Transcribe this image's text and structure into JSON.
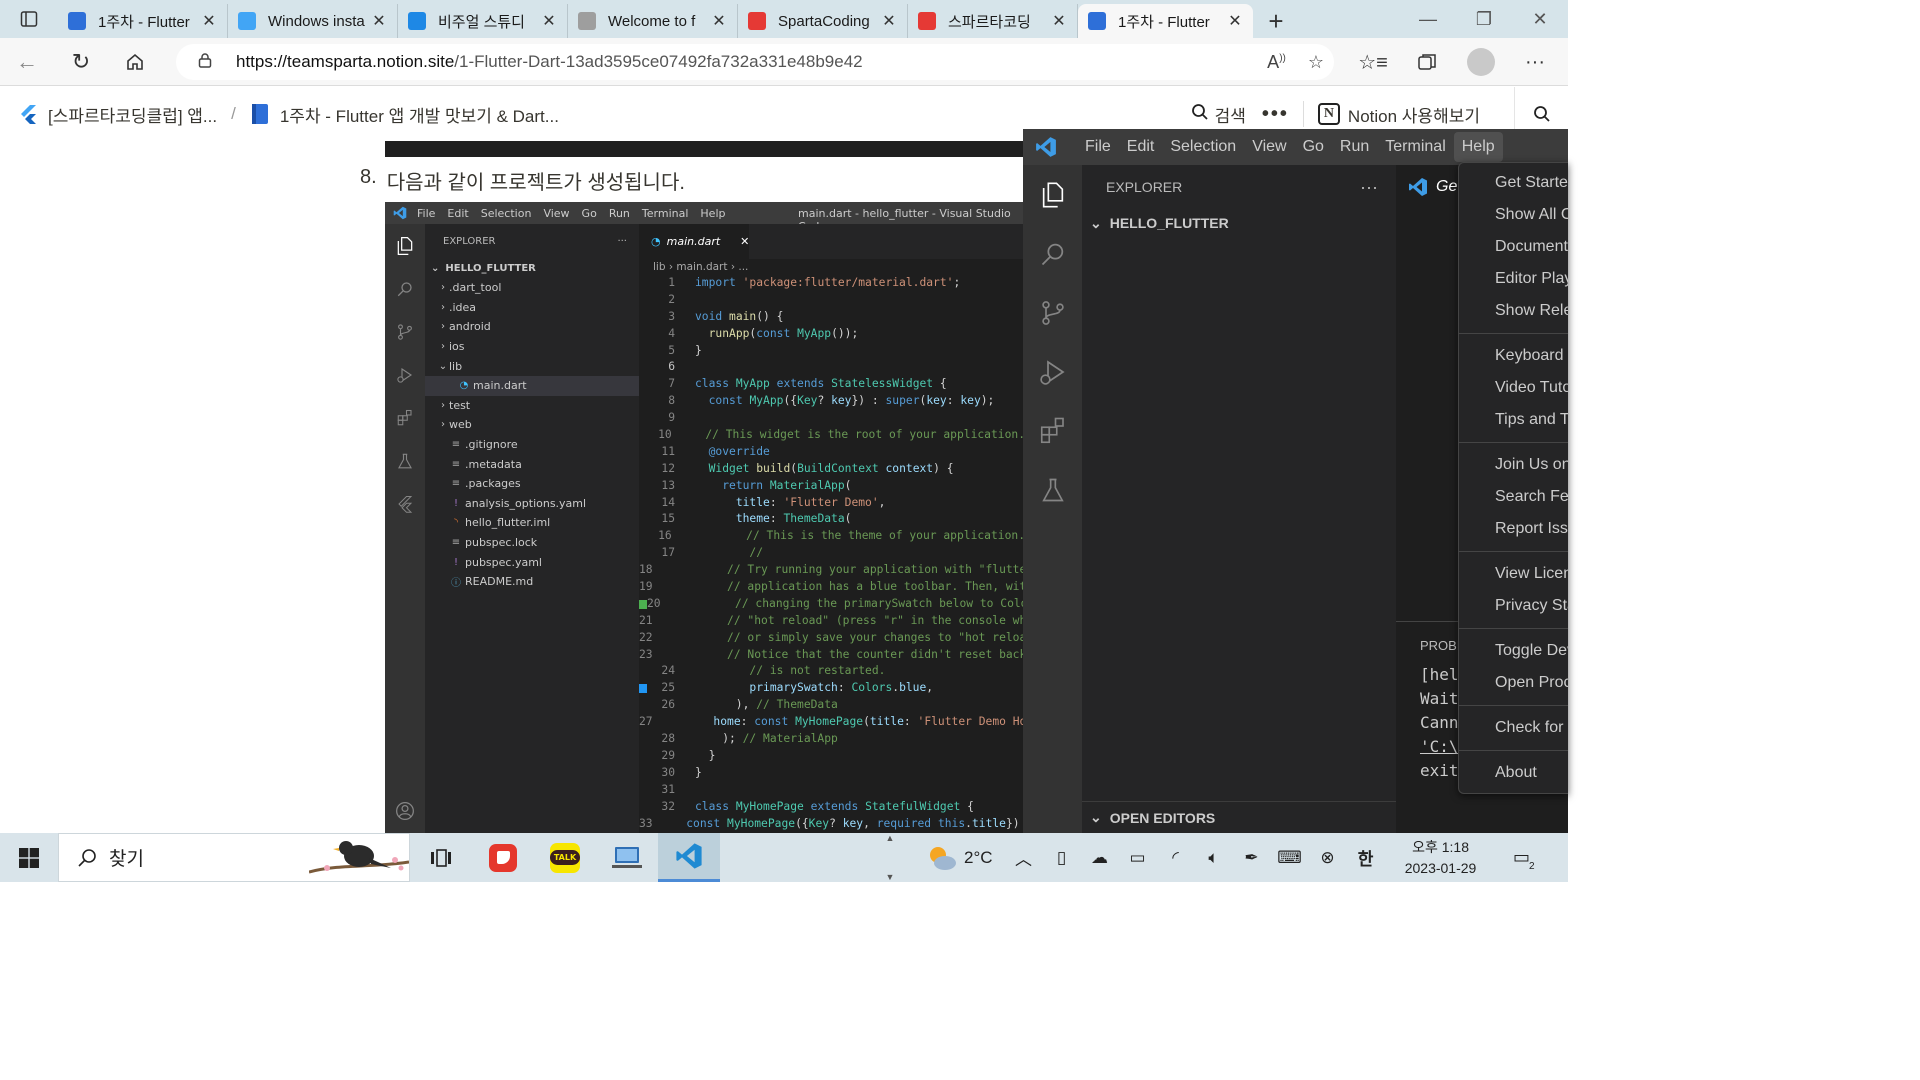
{
  "browser": {
    "tabs": [
      {
        "title": "1주차 - Flutter",
        "favicon": "notion-page-icon",
        "color": "#2e6fd8",
        "active": false
      },
      {
        "title": "Windows insta",
        "favicon": "flutter-icon",
        "color": "#42a5f5",
        "active": false
      },
      {
        "title": "비주얼 스튜디",
        "favicon": "vscode-icon",
        "color": "#1e88e5",
        "active": false
      },
      {
        "title": "Welcome to f",
        "favicon": "globe-icon",
        "color": "#9e9e9e",
        "active": false
      },
      {
        "title": "SpartaCoding",
        "favicon": "sparta-icon",
        "color": "#e53935",
        "active": false
      },
      {
        "title": "스파르타코딩",
        "favicon": "sparta-heart-icon",
        "color": "#e53935",
        "active": false
      },
      {
        "title": "1주차 - Flutter",
        "favicon": "notion-page-icon",
        "color": "#2e6fd8",
        "active": true
      }
    ],
    "url_host": "https://teamsparta.notion.site",
    "url_path": "/1-Flutter-Dart-13ad3595ce07492fa732a331e48b9e42"
  },
  "notion": {
    "breadcrumb_1": "[스파르타코딩클럽] 앱...",
    "breadcrumb_2": "1주차 - Flutter 앱 개발 맛보기 & Dart...",
    "search_label": "검색",
    "try_label": "Notion 사용해보기",
    "step_number": "8.",
    "step_text": "다음과 같이 프로젝트가 생성됩니다."
  },
  "screenshot": {
    "menu": [
      "File",
      "Edit",
      "Selection",
      "View",
      "Go",
      "Run",
      "Terminal",
      "Help"
    ],
    "window_title": "main.dart - hello_flutter - Visual Studio Code",
    "explorer_label": "EXPLORER",
    "project": "HELLO_FLUTTER",
    "tree": [
      {
        "name": ".dart_tool",
        "kind": "folder",
        "depth": 1
      },
      {
        "name": ".idea",
        "kind": "folder",
        "depth": 1
      },
      {
        "name": "android",
        "kind": "folder",
        "depth": 1
      },
      {
        "name": "ios",
        "kind": "folder",
        "depth": 1
      },
      {
        "name": "lib",
        "kind": "folder-open",
        "depth": 1
      },
      {
        "name": "main.dart",
        "kind": "dart",
        "depth": 2
      },
      {
        "name": "test",
        "kind": "folder",
        "depth": 1
      },
      {
        "name": "web",
        "kind": "folder",
        "depth": 1
      },
      {
        "name": ".gitignore",
        "kind": "file",
        "depth": 1
      },
      {
        "name": ".metadata",
        "kind": "file",
        "depth": 1
      },
      {
        "name": ".packages",
        "kind": "file",
        "depth": 1
      },
      {
        "name": "analysis_options.yaml",
        "kind": "yaml",
        "depth": 1
      },
      {
        "name": "hello_flutter.iml",
        "kind": "rss",
        "depth": 1
      },
      {
        "name": "pubspec.lock",
        "kind": "file",
        "depth": 1
      },
      {
        "name": "pubspec.yaml",
        "kind": "yaml",
        "depth": 1
      },
      {
        "name": "README.md",
        "kind": "info",
        "depth": 1
      }
    ],
    "editor_tab": "main.dart",
    "editor_breadcrumb": "lib  ›  main.dart  ›  ...",
    "code_lines": [
      "import 'package:flutter/material.dart';",
      "",
      "void main() {",
      "  runApp(const MyApp());",
      "}",
      "",
      "class MyApp extends StatelessWidget {",
      "  const MyApp({Key? key}) : super(key: key);",
      "",
      "  // This widget is the root of your application.",
      "  @override",
      "  Widget build(BuildContext context) {",
      "    return MaterialApp(",
      "      title: 'Flutter Demo',",
      "      theme: ThemeData(",
      "        // This is the theme of your application.",
      "        //",
      "        // Try running your application with \"flutter run\".",
      "        // application has a blue toolbar. Then, without quitting",
      "        // changing the primarySwatch below to Colors.green",
      "        // \"hot reload\" (press \"r\" in the console where you ran",
      "        // or simply save your changes to \"hot reload\" in a",
      "        // Notice that the counter didn't reset back to zero",
      "        // is not restarted.",
      "        primarySwatch: Colors.blue,",
      "      ), // ThemeData",
      "      home: const MyHomePage(title: 'Flutter Demo Home Page'),",
      "    ); // MaterialApp",
      "  }",
      "}",
      "",
      "class MyHomePage extends StatefulWidget {",
      "  const MyHomePage({Key? key, required this.title}) : super(key: key);"
    ]
  },
  "vscode": {
    "menu": [
      "File",
      "Edit",
      "Selection",
      "View",
      "Go",
      "Run",
      "Terminal",
      "Help"
    ],
    "explorer_label": "EXPLORER",
    "project": "HELLO_FLUTTER",
    "open_editors": "OPEN EDITORS",
    "get_started_tab": "Get",
    "panel_title": "PROBL",
    "terminal_lines": [
      "[hel",
      "Wait",
      "Cann",
      "'C:\\",
      "exit"
    ],
    "help_menu": [
      [
        "Get Started",
        "Show All Commands",
        "Documentation",
        "Editor Playground",
        "Show Release Notes"
      ],
      [
        "Keyboard Shortcuts Reference",
        "Video Tutorials",
        "Tips and Tricks"
      ],
      [
        "Join Us on YouTube",
        "Search Feature Requests",
        "Report Issue"
      ],
      [
        "View License",
        "Privacy Statement"
      ],
      [
        "Toggle Developer Tools",
        "Open Process Explorer"
      ],
      [
        "Check for Updates..."
      ],
      [
        "About"
      ]
    ]
  },
  "taskbar": {
    "search_label": "찾기",
    "weather": "2°C",
    "time": "오후 1:18",
    "date": "2023-01-29",
    "notification_count": "2"
  }
}
